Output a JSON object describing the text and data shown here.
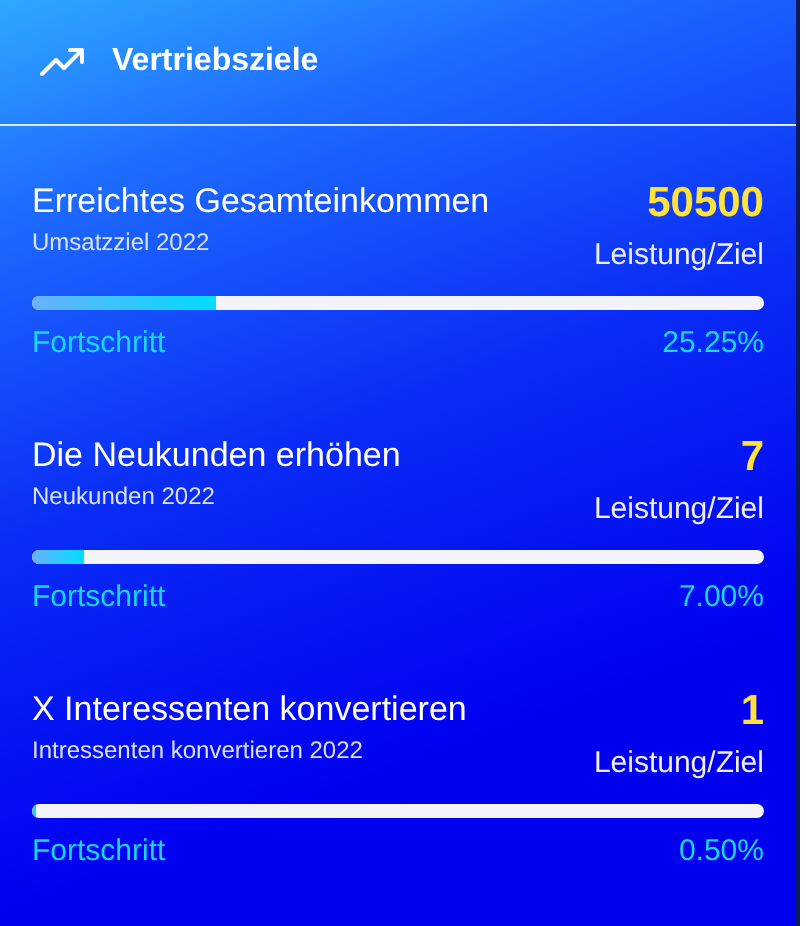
{
  "header": {
    "title": "Vertriebsziele"
  },
  "goals": [
    {
      "title": "Erreichtes Gesamteinkommen",
      "subtitle": "Umsatzziel 2022",
      "value": "50500",
      "value_label": "Leistung/Ziel",
      "progress_label": "Fortschritt",
      "percent": "25.25%",
      "level": 0.2525
    },
    {
      "title": "Die Neukunden erhöhen",
      "subtitle": "Neukunden 2022",
      "value": "7",
      "value_label": "Leistung/Ziel",
      "progress_label": "Fortschritt",
      "percent": "7.00%",
      "level": 0.07
    },
    {
      "title": "X Interessenten konvertieren",
      "subtitle": "Intressenten konvertieren 2022",
      "value": "1",
      "value_label": "Leistung/Ziel",
      "progress_label": "Fortschritt",
      "percent": "0.50%",
      "level": 0.005
    }
  ]
}
